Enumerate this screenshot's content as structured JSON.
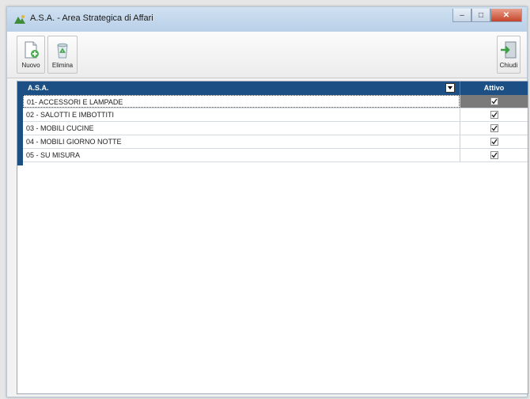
{
  "window": {
    "title": "A.S.A. - Area Strategica di Affari",
    "minimize_label": "–",
    "maximize_label": "□",
    "close_label": "✕"
  },
  "toolbar": {
    "new_label": "Nuovo",
    "delete_label": "Elimina",
    "close_label": "Chiudi"
  },
  "grid": {
    "columns": [
      "A.S.A.",
      "Attivo"
    ],
    "rows": [
      {
        "name": "01- ACCESSORI E LAMPADE",
        "active": true,
        "selected": true
      },
      {
        "name": "02 - SALOTTI E IMBOTTITI",
        "active": true,
        "selected": false
      },
      {
        "name": "03 - MOBILI CUCINE",
        "active": true,
        "selected": false
      },
      {
        "name": "04 - MOBILI GIORNO NOTTE",
        "active": true,
        "selected": false
      },
      {
        "name": "05 - SU MISURA",
        "active": true,
        "selected": false
      }
    ]
  },
  "colors": {
    "header_bg": "#1c4f84",
    "selected_cell": "#7a7a7a"
  }
}
